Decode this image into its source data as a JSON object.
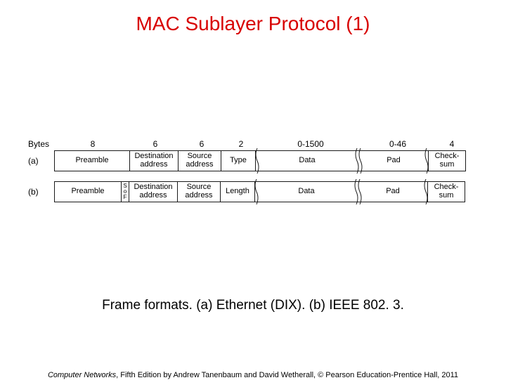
{
  "title": "MAC Sublayer Protocol (1)",
  "bytes_label": "Bytes",
  "widths": [
    "8",
    "6",
    "6",
    "2",
    "0-1500",
    "0-46",
    "4"
  ],
  "rows": {
    "a": {
      "label": "(a)",
      "cells": {
        "preamble": "Preamble",
        "dest": "Destination address",
        "src": "Source address",
        "type": "Type",
        "data": "Data",
        "pad": "Pad",
        "chk": "Check-sum"
      }
    },
    "b": {
      "label": "(b)",
      "cells": {
        "preamble": "Preamble",
        "sof": "S o F",
        "dest": "Destination address",
        "src": "Source address",
        "length": "Length",
        "data": "Data",
        "pad": "Pad",
        "chk": "Check-sum"
      }
    }
  },
  "caption": "Frame formats. (a) Ethernet (DIX). (b) IEEE 802. 3.",
  "footer": {
    "ital": "Computer Networks",
    "rest": ", Fifth Edition by Andrew Tanenbaum and David Wetherall, © Pearson Education-Prentice Hall, 2011"
  }
}
